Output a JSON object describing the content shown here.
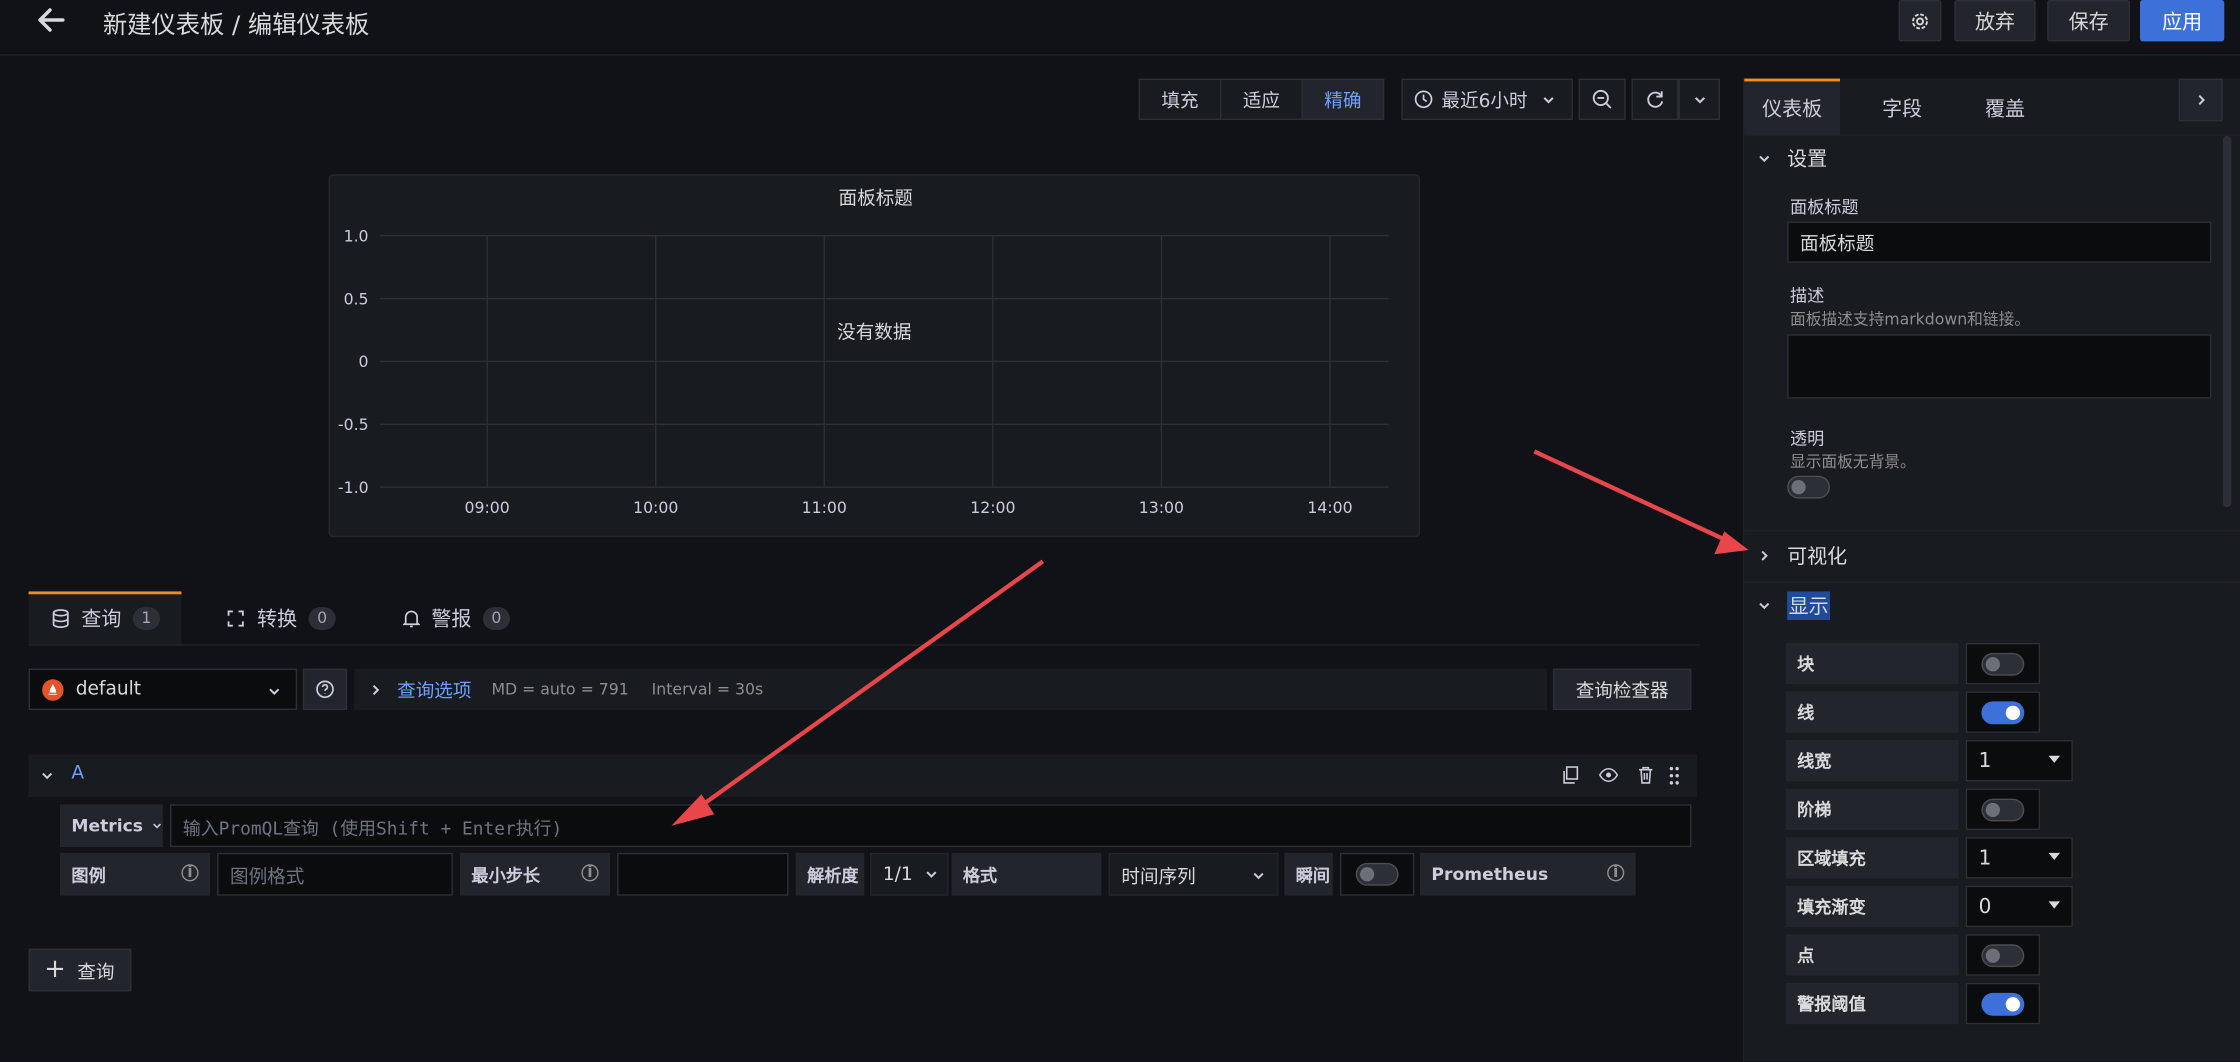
{
  "header": {
    "back_icon": "arrow-left-icon",
    "title": "新建仪表板 / 编辑仪表板",
    "discard": "放弃",
    "save": "保存",
    "apply": "应用"
  },
  "toolbar": {
    "fill": "填充",
    "fit": "适应",
    "exact": "精确",
    "time_range": "最近6小时"
  },
  "panel": {
    "title": "面板标题",
    "no_data": "没有数据",
    "chart_data": {
      "type": "line",
      "title": "面板标题",
      "y_ticks": [
        "1.0",
        "0.5",
        "0",
        "-0.5",
        "-1.0"
      ],
      "ylim": [
        -1,
        1
      ],
      "x_ticks": [
        "09:00",
        "10:00",
        "11:00",
        "12:00",
        "13:00",
        "14:00"
      ],
      "series": [],
      "grid": true,
      "annotation": "没有数据"
    }
  },
  "query_tabs": [
    {
      "label": "查询",
      "count": "1",
      "icon": "database-icon"
    },
    {
      "label": "转换",
      "count": "0",
      "icon": "transform-icon"
    },
    {
      "label": "警报",
      "count": "0",
      "icon": "bell-icon"
    }
  ],
  "datasource": {
    "name": "default",
    "options_label": "查询选项",
    "md": "MD = auto = 791",
    "interval": "Interval = 30s",
    "inspector": "查询检查器"
  },
  "query_a": {
    "ref": "A",
    "metrics": "Metrics",
    "placeholder": "输入PromQL查询 (使用Shift + Enter执行)",
    "legend": "图例",
    "legend_placeholder": "图例格式",
    "min_step": "最小步长",
    "resolution": "解析度",
    "resolution_value": "1/1",
    "format": "格式",
    "format_value": "时间序列",
    "instant": "瞬间",
    "instant_on": false,
    "prometheus": "Prometheus"
  },
  "add_query": "查询",
  "sidebar": {
    "tabs": [
      "仪表板",
      "字段",
      "覆盖"
    ],
    "settings": "设置",
    "panel_title_label": "面板标题",
    "panel_title_value": "面板标题",
    "description_label": "描述",
    "description_hint": "面板描述支持markdown和链接。",
    "transparent_label": "透明",
    "transparent_hint": "显示面板无背景。",
    "transparent_on": false,
    "visualization": "可视化",
    "display": "显示",
    "display_options": [
      {
        "label": "块",
        "type": "toggle",
        "on": false
      },
      {
        "label": "线",
        "type": "toggle",
        "on": true
      },
      {
        "label": "线宽",
        "type": "select",
        "value": "1"
      },
      {
        "label": "阶梯",
        "type": "toggle",
        "on": false
      },
      {
        "label": "区域填充",
        "type": "select",
        "value": "1"
      },
      {
        "label": "填充渐变",
        "type": "select",
        "value": "0"
      },
      {
        "label": "点",
        "type": "toggle",
        "on": false
      },
      {
        "label": "警报阈值",
        "type": "toggle",
        "on": true
      }
    ]
  }
}
